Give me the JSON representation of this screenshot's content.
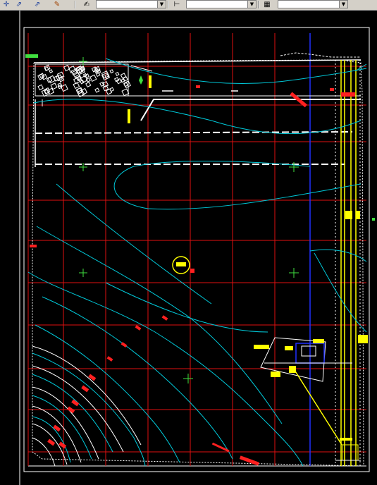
{
  "toolbar": {
    "icons": [
      "select-arrow-icon",
      "pointer-icon",
      "pointer-alt-icon",
      "pan-icon",
      "properties-icon",
      "dimension-icon",
      "layer-icon"
    ],
    "combo_1": {
      "value": ""
    },
    "combo_2": {
      "value": ""
    },
    "combo_3": {
      "value": ""
    },
    "arrow_glyph": "▼"
  },
  "drawing": {
    "background": "#000000",
    "colors": {
      "grid": "#e01010",
      "boundary": "#ffffff",
      "contour": "#00c8d8",
      "road": "#ffff00",
      "crosshair": "#40e040",
      "blue_line": "#2030ff",
      "hatch": "#ffffff"
    }
  }
}
